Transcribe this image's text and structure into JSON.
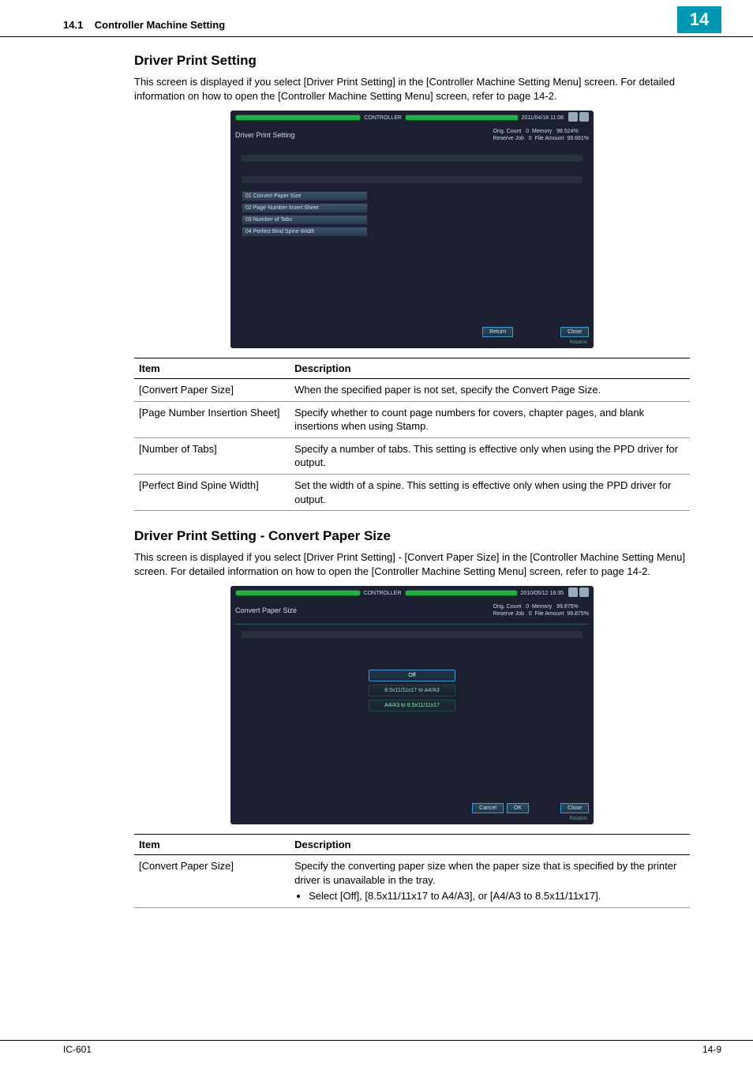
{
  "header": {
    "section_number": "14.1",
    "section_title": "Controller Machine Setting",
    "chapter_badge": "14"
  },
  "section1": {
    "heading": "Driver Print Setting",
    "paragraph": "This screen is displayed if you select [Driver Print Setting] in the [Controller Machine Setting Menu] screen. For detailed information on how to open the [Controller Machine Setting Menu] screen, refer to page 14-2.",
    "panel": {
      "controller_label": "CONTROLLER",
      "datetime": "2011/04/18 11:08",
      "title": "Driver Print Setting",
      "stats_line1_l": "Orig. Count",
      "stats_line1_c": "0",
      "stats_line1_rlabel": "Memory",
      "stats_line1_r": "98.524%",
      "stats_line2_l": "Reserve Job",
      "stats_line2_c": "0",
      "stats_line2_rlabel": "File Amount",
      "stats_line2_r": "99.681%",
      "menu_items": [
        "01 Convert Paper Size",
        "02 Page Number Insert Sheet",
        "03 Number of Tabs",
        "04 Perfect Bind Spine Width"
      ],
      "btn_return": "Return",
      "btn_close": "Close",
      "rotation_label": "Rotation"
    },
    "table": {
      "col_item": "Item",
      "col_desc": "Description",
      "rows": [
        {
          "item": "[Convert Paper Size]",
          "desc": "When the specified paper is not set, specify the Convert Page Size."
        },
        {
          "item": "[Page Number Insertion Sheet]",
          "desc": "Specify whether to count page numbers for covers, chapter pages, and blank insertions when using Stamp."
        },
        {
          "item": "[Number of Tabs]",
          "desc": "Specify a number of tabs. This setting is effective only when using the PPD driver for output."
        },
        {
          "item": "[Perfect Bind Spine Width]",
          "desc": "Set the width of a spine. This setting is effective only when using the PPD driver for output."
        }
      ]
    }
  },
  "section2": {
    "heading": "Driver Print Setting  - Convert Paper Size",
    "paragraph": "This screen is displayed if you select [Driver Print Setting] - [Convert Paper Size] in the [Controller Machine Setting Menu] screen. For detailed information on how to open the [Controller Machine Setting Menu] screen, refer to page 14-2.",
    "panel": {
      "controller_label": "CONTROLLER",
      "datetime": "2010/05/12 16:35",
      "title": "Convert Paper Size",
      "stats_line1_l": "Orig. Count",
      "stats_line1_c": "0",
      "stats_line1_rlabel": "Memory",
      "stats_line1_r": "99.875%",
      "stats_line2_l": "Reserve Job",
      "stats_line2_c": "0",
      "stats_line2_rlabel": "File Amount",
      "stats_line2_r": "99.875%",
      "options": [
        {
          "label": "Off",
          "selected": true
        },
        {
          "label": "8.5x11/11x17 to A4/A3",
          "selected": false
        },
        {
          "label": "A4/A3 to 8.5x11/11x17",
          "selected": false
        }
      ],
      "btn_cancel": "Cancel",
      "btn_ok": "OK",
      "btn_close": "Close",
      "rotation_label": "Rotation"
    },
    "table": {
      "col_item": "Item",
      "col_desc": "Description",
      "row_item": "[Convert Paper Size]",
      "row_desc_line": "Specify the converting paper size when the paper size that is specified by the printer driver is unavailable in the tray.",
      "row_bullet": "Select [Off], [8.5x11/11x17 to A4/A3], or [A4/A3 to 8.5x11/11x17]."
    }
  },
  "footer": {
    "left": "IC-601",
    "right": "14-9"
  }
}
